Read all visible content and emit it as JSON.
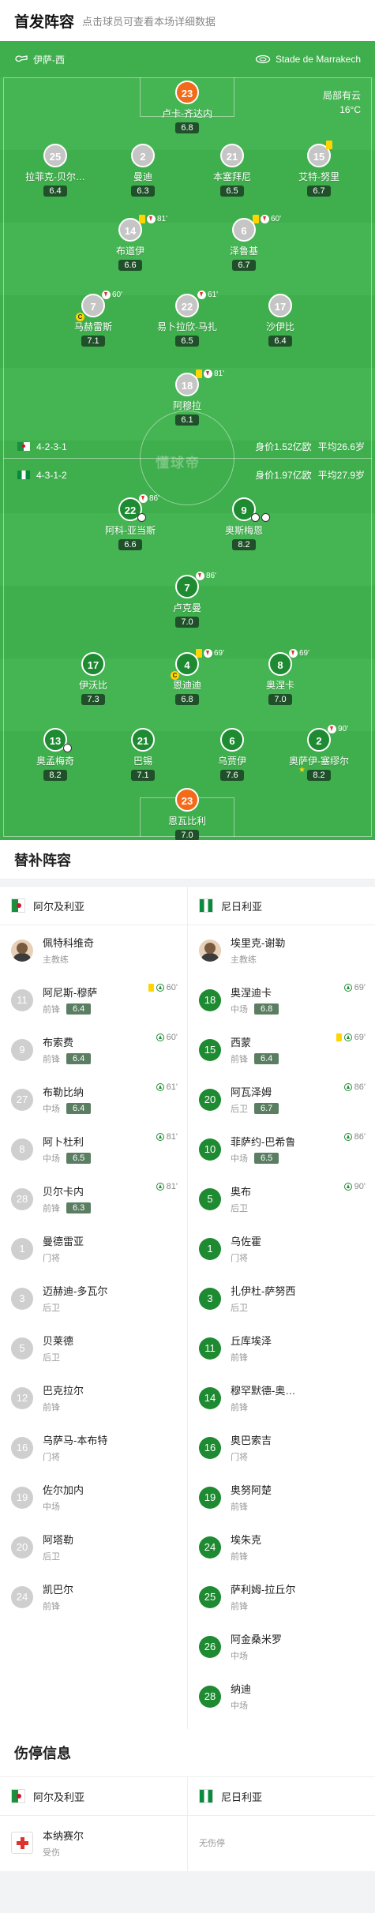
{
  "header": {
    "title": "首发阵容",
    "subtitle": "点击球员可查看本场详细数据"
  },
  "pitch_top": {
    "home_name": "伊萨-西",
    "venue": "Stade de Marrakech"
  },
  "weather": {
    "condition": "局部有云",
    "temp": "16°C"
  },
  "watermark": "懂球帝",
  "home_info": {
    "formation": "4-2-3-1",
    "value": "身价1.52亿欧",
    "age": "平均26.6岁"
  },
  "away_info": {
    "formation": "4-3-1-2",
    "value": "身价1.97亿欧",
    "age": "平均27.9岁"
  },
  "home_players": [
    {
      "num": "23",
      "name": "卢卡-齐达内",
      "rating": "6.8"
    },
    {
      "num": "25",
      "name": "拉菲克-贝尔…",
      "rating": "6.4"
    },
    {
      "num": "2",
      "name": "曼迪",
      "rating": "6.3"
    },
    {
      "num": "21",
      "name": "本塞拜尼",
      "rating": "6.5"
    },
    {
      "num": "15",
      "name": "艾特-努里",
      "rating": "6.7"
    },
    {
      "num": "14",
      "name": "布道伊",
      "rating": "6.6",
      "event": "81'"
    },
    {
      "num": "6",
      "name": "泽鲁基",
      "rating": "6.7",
      "event": "60'"
    },
    {
      "num": "7",
      "name": "马赫雷斯",
      "rating": "7.1",
      "event": "60'"
    },
    {
      "num": "22",
      "name": "易卜拉欣-马扎",
      "rating": "6.5",
      "event": "61'"
    },
    {
      "num": "17",
      "name": "沙伊比",
      "rating": "6.4"
    },
    {
      "num": "18",
      "name": "阿穆拉",
      "rating": "6.1",
      "event": "81'"
    }
  ],
  "away_players": [
    {
      "num": "22",
      "name": "阿科-亚当斯",
      "rating": "6.6",
      "event": "86'"
    },
    {
      "num": "9",
      "name": "奥斯梅恩",
      "rating": "8.2"
    },
    {
      "num": "7",
      "name": "卢克曼",
      "rating": "7.0",
      "event": "86'"
    },
    {
      "num": "17",
      "name": "伊沃比",
      "rating": "7.3"
    },
    {
      "num": "4",
      "name": "恩迪迪",
      "rating": "6.8",
      "event": "69'"
    },
    {
      "num": "8",
      "name": "奥涅卡",
      "rating": "7.0",
      "event": "69'"
    },
    {
      "num": "13",
      "name": "奥孟梅奇",
      "rating": "8.2"
    },
    {
      "num": "21",
      "name": "巴锡",
      "rating": "7.1"
    },
    {
      "num": "6",
      "name": "乌贾伊",
      "rating": "7.6"
    },
    {
      "num": "2",
      "name": "奥萨伊-塞缪尔",
      "rating": "8.2",
      "event": "90'"
    },
    {
      "num": "23",
      "name": "恩瓦比利",
      "rating": "7.0"
    }
  ],
  "subs": {
    "title": "替补阵容",
    "home_team": "阿尔及利亚",
    "away_team": "尼日利亚",
    "home_coach": {
      "name": "佩特科维奇",
      "role": "主教练"
    },
    "away_coach": {
      "name": "埃里克-谢勒",
      "role": "主教练"
    },
    "home": [
      {
        "num": "11",
        "name": "阿尼斯-穆萨",
        "pos": "前锋",
        "rating": "6.4",
        "event": "60'"
      },
      {
        "num": "9",
        "name": "布索费",
        "pos": "前锋",
        "rating": "6.4",
        "event": "60'"
      },
      {
        "num": "27",
        "name": "布勒比纳",
        "pos": "中场",
        "rating": "6.4",
        "event": "61'"
      },
      {
        "num": "8",
        "name": "阿卜杜利",
        "pos": "中场",
        "rating": "6.5",
        "event": "81'"
      },
      {
        "num": "28",
        "name": "贝尔卡内",
        "pos": "前锋",
        "rating": "6.3",
        "event": "81'"
      },
      {
        "num": "1",
        "name": "曼德雷亚",
        "pos": "门将"
      },
      {
        "num": "3",
        "name": "迈赫迪-多瓦尔",
        "pos": "后卫"
      },
      {
        "num": "5",
        "name": "贝莱德",
        "pos": "后卫"
      },
      {
        "num": "12",
        "name": "巴克拉尔",
        "pos": "前锋"
      },
      {
        "num": "16",
        "name": "乌萨马-本布特",
        "pos": "门将"
      },
      {
        "num": "19",
        "name": "佐尔加内",
        "pos": "中场"
      },
      {
        "num": "20",
        "name": "阿塔勒",
        "pos": "后卫"
      },
      {
        "num": "24",
        "name": "凯巴尔",
        "pos": "前锋"
      }
    ],
    "away": [
      {
        "num": "18",
        "name": "奥涅迪卡",
        "pos": "中场",
        "rating": "6.8",
        "event": "69'"
      },
      {
        "num": "15",
        "name": "西蒙",
        "pos": "前锋",
        "rating": "6.4",
        "event": "69'"
      },
      {
        "num": "20",
        "name": "阿瓦泽姆",
        "pos": "后卫",
        "rating": "6.7",
        "event": "86'"
      },
      {
        "num": "10",
        "name": "菲萨约-巴希鲁",
        "pos": "中场",
        "rating": "6.5",
        "event": "86'"
      },
      {
        "num": "5",
        "name": "奥布",
        "pos": "后卫",
        "event": "90'"
      },
      {
        "num": "1",
        "name": "乌佐霍",
        "pos": "门将"
      },
      {
        "num": "3",
        "name": "扎伊杜-萨努西",
        "pos": "后卫"
      },
      {
        "num": "11",
        "name": "丘库埃泽",
        "pos": "前锋"
      },
      {
        "num": "14",
        "name": "穆罕默德-奥…",
        "pos": "前锋"
      },
      {
        "num": "16",
        "name": "奥巴索吉",
        "pos": "门将"
      },
      {
        "num": "19",
        "name": "奥努阿楚",
        "pos": "前锋"
      },
      {
        "num": "24",
        "name": "埃朱克",
        "pos": "前锋"
      },
      {
        "num": "25",
        "name": "萨利姆-拉丘尔",
        "pos": "前锋"
      },
      {
        "num": "26",
        "name": "阿金桑米罗",
        "pos": "中场"
      },
      {
        "num": "28",
        "name": "纳迪",
        "pos": "中场"
      }
    ]
  },
  "injuries": {
    "title": "伤停信息",
    "home_team": "阿尔及利亚",
    "away_team": "尼日利亚",
    "home": [
      {
        "name": "本纳赛尔",
        "status": "受伤"
      }
    ],
    "away_none": "无伤停"
  }
}
